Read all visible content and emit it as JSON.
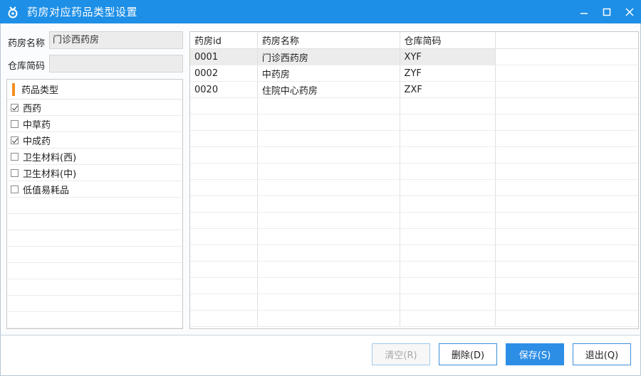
{
  "window": {
    "title": "药房对应药品类型设置",
    "accent": "#1e8fe6"
  },
  "form": {
    "pharmacy_name_label": "药房名称",
    "pharmacy_name_value": "门诊西药房",
    "warehouse_code_label": "仓库简码",
    "warehouse_code_value": ""
  },
  "drug_types": {
    "header": "药品类型",
    "items": [
      {
        "label": "西药",
        "checked": true
      },
      {
        "label": "中草药",
        "checked": false
      },
      {
        "label": "中成药",
        "checked": true
      },
      {
        "label": "卫生材料(西)",
        "checked": false
      },
      {
        "label": "卫生材料(中)",
        "checked": false
      },
      {
        "label": "低值易耗品",
        "checked": false
      }
    ]
  },
  "grid": {
    "columns": [
      "药房id",
      "药房名称",
      "仓库简码",
      ""
    ],
    "rows": [
      [
        "0001",
        "门诊西药房",
        "XYF"
      ],
      [
        "0002",
        "中药房",
        "ZYF"
      ],
      [
        "0020",
        "住院中心药房",
        "ZXF"
      ]
    ],
    "selected_index": 0
  },
  "buttons": {
    "clear": "清空(R)",
    "delete": "删除(D)",
    "save": "保存(S)",
    "exit": "退出(Q)"
  }
}
